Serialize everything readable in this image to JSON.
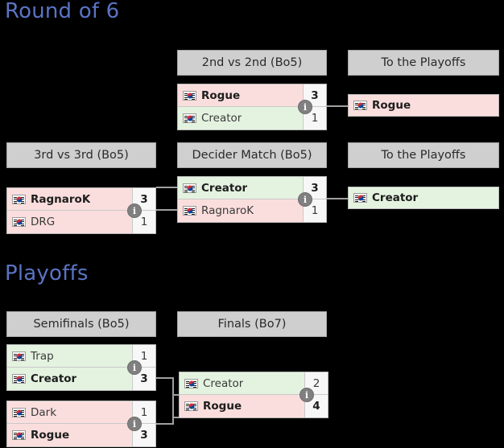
{
  "sections": [
    {
      "title": "Round of 6"
    },
    {
      "title": "Playoffs"
    }
  ],
  "headers": {
    "second_vs_second": "2nd vs 2nd (Bo5)",
    "to_playoffs_1": "To the Playoffs",
    "third_vs_third": "3rd vs 3rd (Bo5)",
    "decider": "Decider Match (Bo5)",
    "to_playoffs_2": "To the Playoffs",
    "semifinals": "Semifinals (Bo5)",
    "finals": "Finals (Bo7)"
  },
  "matches": {
    "second_vs_second": {
      "top": {
        "name": "Rogue",
        "score": "3",
        "winner": true,
        "flag": "south-korea-flag-icon"
      },
      "bottom": {
        "name": "Creator",
        "score": "1",
        "winner": false,
        "flag": "south-korea-flag-icon"
      },
      "info": "i"
    },
    "third_vs_third": {
      "top": {
        "name": "RagnaroK",
        "score": "3",
        "winner": true,
        "flag": "south-korea-flag-icon"
      },
      "bottom": {
        "name": "DRG",
        "score": "1",
        "winner": false,
        "flag": "south-korea-flag-icon"
      },
      "info": "i"
    },
    "decider": {
      "top": {
        "name": "Creator",
        "score": "3",
        "winner": true,
        "flag": "south-korea-flag-icon"
      },
      "bottom": {
        "name": "RagnaroK",
        "score": "1",
        "winner": false,
        "flag": "south-korea-flag-icon"
      },
      "info": "i"
    },
    "semifinal_1": {
      "top": {
        "name": "Trap",
        "score": "1",
        "winner": false,
        "flag": "south-korea-flag-icon"
      },
      "bottom": {
        "name": "Creator",
        "score": "3",
        "winner": true,
        "flag": "south-korea-flag-icon"
      },
      "info": "i"
    },
    "semifinal_2": {
      "top": {
        "name": "Dark",
        "score": "1",
        "winner": false,
        "flag": "south-korea-flag-icon"
      },
      "bottom": {
        "name": "Rogue",
        "score": "3",
        "winner": true,
        "flag": "south-korea-flag-icon"
      },
      "info": "i"
    },
    "finals": {
      "top": {
        "name": "Creator",
        "score": "2",
        "winner": false,
        "flag": "south-korea-flag-icon"
      },
      "bottom": {
        "name": "Rogue",
        "score": "4",
        "winner": true,
        "flag": "south-korea-flag-icon"
      },
      "info": "i"
    }
  },
  "qualified": {
    "rogue": {
      "name": "Rogue",
      "flag": "south-korea-flag-icon"
    },
    "creator": {
      "name": "Creator",
      "flag": "south-korea-flag-icon"
    }
  },
  "colors": {
    "winner_green": "#e4f3e0",
    "loser_pink": "#fadedd",
    "header_gray": "#cfcfcf",
    "section_title_blue": "#5b73c4",
    "background": "#000000",
    "connector_gray": "#a0a0a0"
  }
}
